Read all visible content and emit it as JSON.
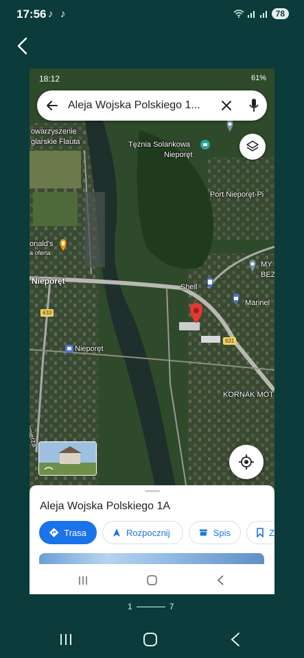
{
  "outer_status": {
    "time": "17:56",
    "battery": "78"
  },
  "screenshot": {
    "status": {
      "time": "18:12",
      "battery": "61%"
    },
    "search": {
      "query": "Aleja Wojska Polskiego 1..."
    },
    "map_labels": {
      "label1": "owarzyszenie",
      "label2": "glarskie Flauta",
      "tezna": "Tężnia Solankowa",
      "tezna2": "Nieporęt",
      "port": "Port Nieporęt-Pi",
      "mcd": "onald's",
      "mcd2": "a oferta",
      "nieporet": "Nieporęt",
      "shell": "Shell",
      "marinel": "Marinel",
      "my": "MY",
      "bez": "BEZ",
      "road633": "633",
      "road631": "631",
      "bus": "Nieporęt",
      "kornak": "KORNAK MOT",
      "street": "Jana Kazimierza"
    },
    "sheet": {
      "title": "Aleja Wojska Polskiego 1A",
      "chips": [
        "Trasa",
        "Rozpocznij",
        "Spis",
        "Z"
      ]
    }
  },
  "pager": {
    "start": "1",
    "end": "7"
  }
}
